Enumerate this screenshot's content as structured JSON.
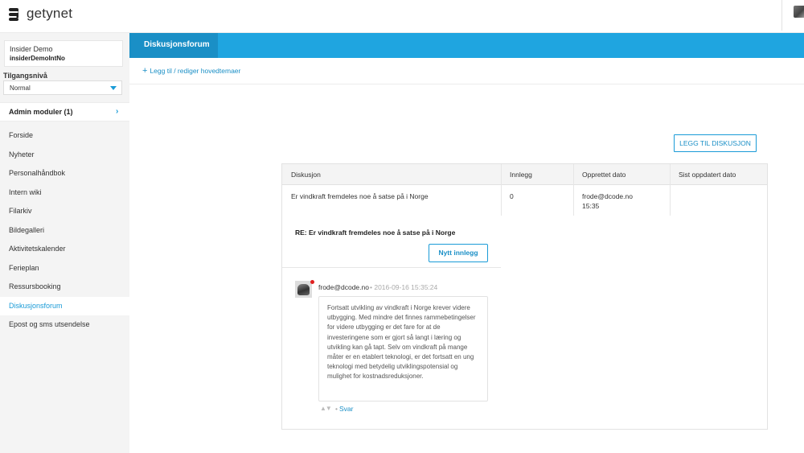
{
  "app": {
    "name": "getynet"
  },
  "user": {
    "name": "Insider Demo",
    "id": "insiderDemoIntNo"
  },
  "access": {
    "label": "Tilgangsnivå",
    "value": "Normal"
  },
  "admin": {
    "label": "Admin moduler (1)"
  },
  "nav": {
    "items": [
      {
        "label": "Forside"
      },
      {
        "label": "Nyheter"
      },
      {
        "label": "Personalhåndbok"
      },
      {
        "label": "Intern wiki"
      },
      {
        "label": "Filarkiv"
      },
      {
        "label": "Bildegalleri"
      },
      {
        "label": "Aktivitetskalender"
      },
      {
        "label": "Ferieplan"
      },
      {
        "label": "Ressursbooking"
      },
      {
        "label": "Diskusjonsforum"
      },
      {
        "label": "Epost og sms utsendelse"
      }
    ],
    "active": "Diskusjonsforum"
  },
  "header": {
    "tab": "Diskusjonsforum"
  },
  "toolbar": {
    "edit_topics": "Legg til / rediger hovedtemaer"
  },
  "actions": {
    "add_discussion": "LEGG TIL DISKUSJON"
  },
  "table": {
    "columns": [
      "Diskusjon",
      "Innlegg",
      "Opprettet dato",
      "Sist oppdatert dato"
    ],
    "rows": [
      {
        "discussion": "Er vindkraft fremdeles noe å satse på i Norge",
        "posts": "0",
        "created_by": "frode@dcode.no",
        "created_time": "15:35",
        "updated": ""
      }
    ]
  },
  "thread": {
    "title": "RE: Er vindkraft fremdeles noe å satse på i Norge",
    "new_post": "Nytt innlegg",
    "post": {
      "author": "frode@dcode.no",
      "date": "• 2016-09-16 15:35:24",
      "body": "Fortsatt utvikling av vindkraft i Norge krever videre utbygging. Med mindre det finnes rammebetingelser for videre utbygging er det fare for at de investeringene som er gjort så langt i læring og utvikling kan gå tapt. Selv om vindkraft på mange måter er en etablert teknologi, er det fortsatt en ung teknologi med betydelig utviklingspotensial og mulighet for kostnadsreduksjoner.",
      "reply": "Svar",
      "reply_sep": "•"
    }
  },
  "colors": {
    "accent": "#1fa5e0",
    "accent_dark": "#1a8fc6",
    "sidebar_bg": "#f4f4f4"
  }
}
